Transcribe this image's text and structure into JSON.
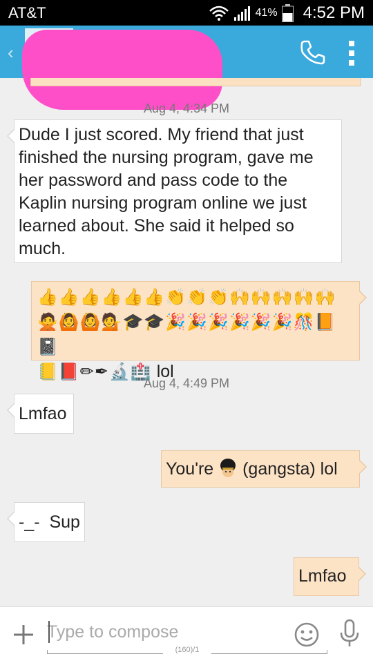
{
  "status_bar": {
    "carrier": "AT&T",
    "battery_percent": "41%",
    "time": "4:52 PM"
  },
  "action_bar": {
    "icons": [
      "back-chevron-icon",
      "call-icon",
      "overflow-menu-icon"
    ],
    "contact_name_redacted": true
  },
  "conversation": {
    "timestamps": [
      "Aug 4, 4:34 PM",
      "Aug 4, 4:49 PM"
    ],
    "messages": [
      {
        "direction": "incoming",
        "text": "Dude I just scored. My friend that just finished the nursing program, gave me her password and pass code to the Kaplin nursing program online we just learned about. She said it helped so much."
      },
      {
        "direction": "outgoing",
        "emoji_line1": "👍👍👍👍👍👍👏👏👏🙌🙌🙌🙌🙌",
        "emoji_line2": "🙅🙆🙆💁🎓🎓🎉🎉🎉🎉🎉🎉🎊📙📓",
        "emoji_line3": "📒📕✏✒🔬🏥",
        "text_suffix": " lol"
      },
      {
        "direction": "incoming",
        "text": "Lmfao"
      },
      {
        "direction": "outgoing",
        "text_before_emoji": "You're ",
        "emoji": "guardsman",
        "text_after_emoji": " (gangsta) lol"
      },
      {
        "direction": "incoming",
        "text": "-_-  Sup"
      },
      {
        "direction": "outgoing",
        "text": "Lmfao"
      }
    ]
  },
  "compose": {
    "placeholder": "Type to compose",
    "char_counter": "(160)/1"
  },
  "colors": {
    "action_bar": "#3aa9dc",
    "incoming_bubble": "#ffffff",
    "outgoing_bubble": "#fde3c6",
    "background": "#efefef",
    "redaction": "#ff4fc8"
  }
}
